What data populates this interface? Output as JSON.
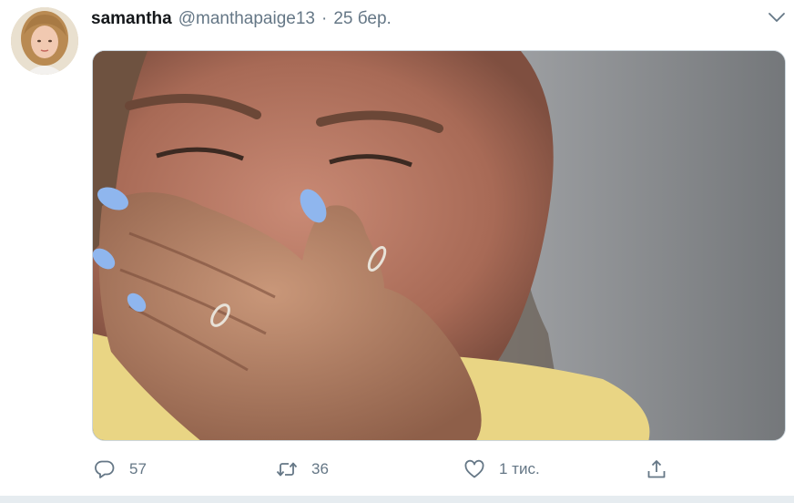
{
  "tweet": {
    "display_name": "samantha",
    "handle": "@manthapaige13",
    "separator": "·",
    "timestamp": "25 бер.",
    "media": {
      "description_icon": "photo"
    },
    "actions": {
      "reply_count": "57",
      "retweet_count": "36",
      "like_count": "1 тис.",
      "share_count": ""
    }
  },
  "colors": {
    "text_primary": "#14171a",
    "text_secondary": "#657786",
    "border": "#ccd6dd",
    "background_strip": "#e6ecf0"
  },
  "icons": {
    "menu": "chevron-down-icon",
    "reply": "reply-icon",
    "retweet": "retweet-icon",
    "like": "heart-icon",
    "share": "share-icon"
  }
}
